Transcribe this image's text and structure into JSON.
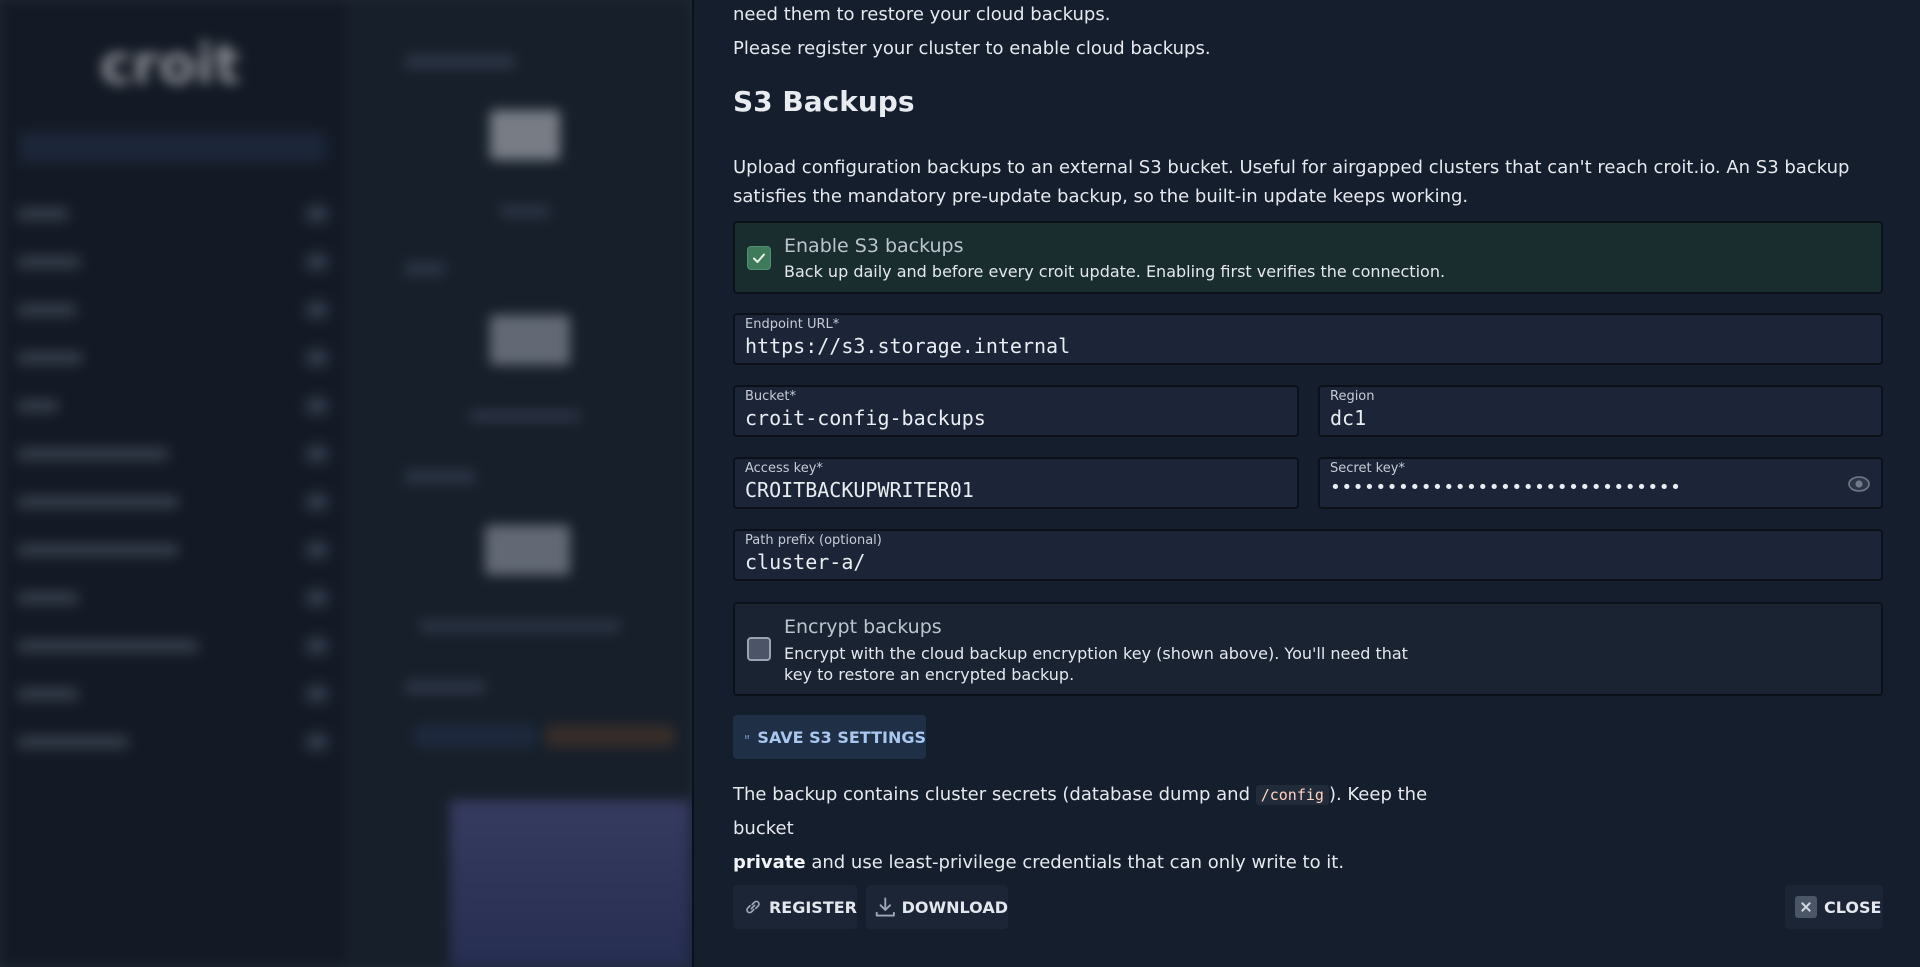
{
  "background": {
    "logo_text": "croit"
  },
  "drawer": {
    "intro": {
      "line1": "need them to restore your cloud backups.",
      "line2": "Please register your cluster to enable cloud backups."
    },
    "s3": {
      "heading": "S3 Backups",
      "description": "Upload configuration backups to an external S3 bucket. Useful for airgapped clusters that can't reach croit.io. An S3 backup satisfies the mandatory pre-update backup, so the built-in update keeps working.",
      "enable": {
        "title": "Enable S3 backups",
        "subtitle": "Back up daily and before every croit update. Enabling first verifies the connection.",
        "checked": true
      },
      "fields": {
        "endpoint": {
          "label": "Endpoint URL*",
          "value": "https://s3.storage.internal"
        },
        "bucket": {
          "label": "Bucket*",
          "value": "croit-config-backups"
        },
        "region": {
          "label": "Region",
          "value": "dc1"
        },
        "access_key": {
          "label": "Access key*",
          "value": "CROITBACKUPWRITER01"
        },
        "secret_key": {
          "label": "Secret key*",
          "value": "•••••••••••••••••••••••••••••••"
        },
        "path_prefix": {
          "label": "Path prefix (optional)",
          "value": "cluster-a/"
        }
      },
      "encrypt": {
        "title": "Encrypt backups",
        "subtitle": "Encrypt with the cloud backup encryption key (shown above). You'll need that key to restore an encrypted backup.",
        "checked": false
      },
      "save_label": "SAVE S3 SETTINGS",
      "note": {
        "part1": "The backup contains cluster secrets (database dump and ",
        "code": "/config",
        "part2": "). Keep the bucket",
        "bold": "private",
        "part3": " and use least-privilege credentials that can only write to it."
      }
    },
    "footer": {
      "register_label": "REGISTER",
      "download_label": "DOWNLOAD",
      "close_label": "CLOSE"
    }
  }
}
